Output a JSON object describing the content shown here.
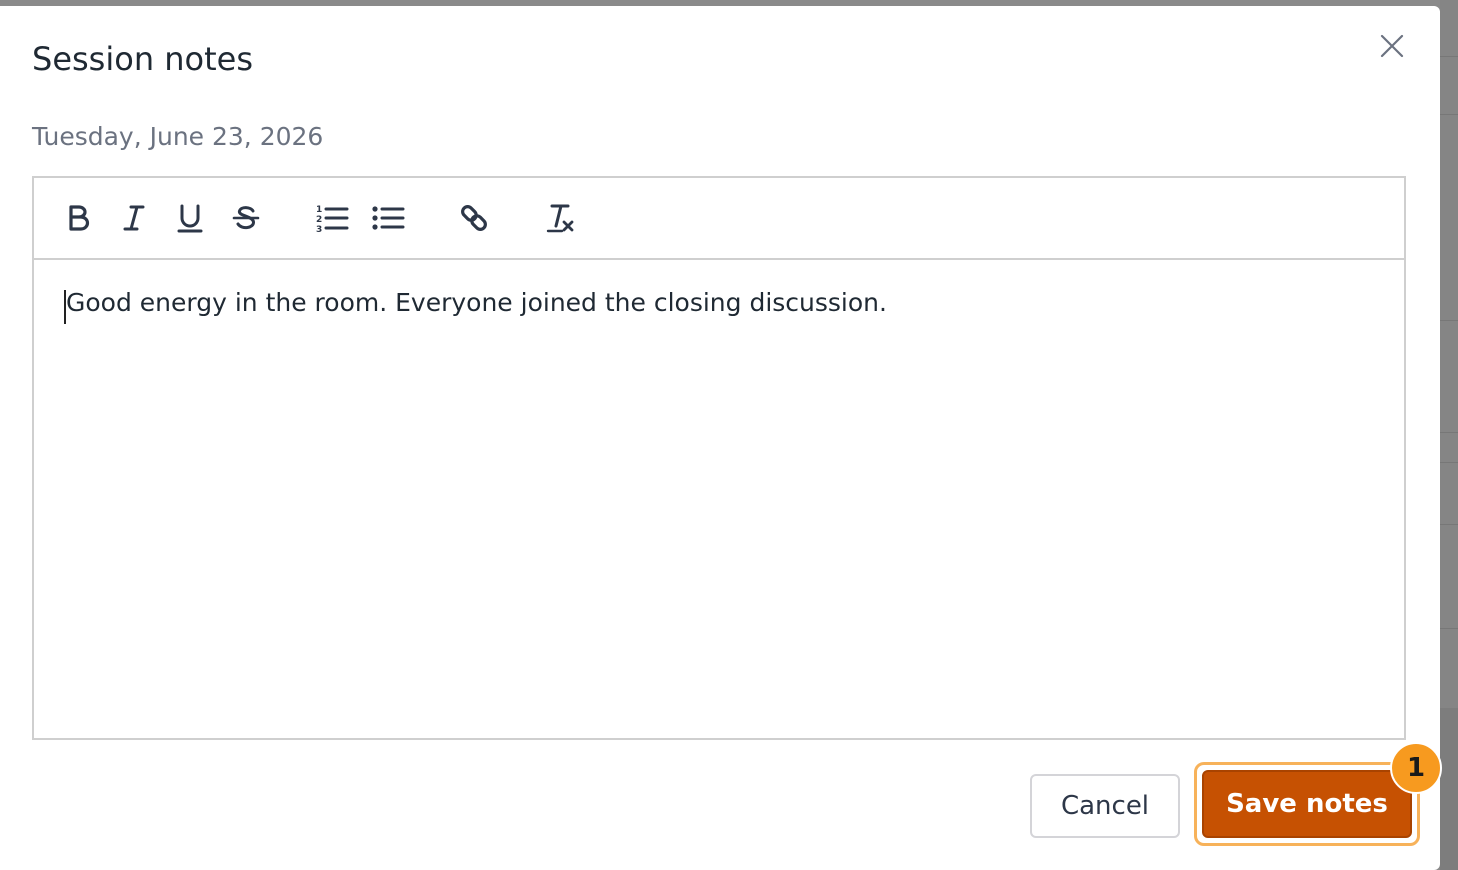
{
  "dialog": {
    "title": "Session notes",
    "date": "Tuesday, June 23, 2026"
  },
  "editor": {
    "toolbar": [
      {
        "name": "bold",
        "icon": "bold-icon"
      },
      {
        "name": "italic",
        "icon": "italic-icon"
      },
      {
        "name": "underline",
        "icon": "underline-icon"
      },
      {
        "name": "strikethrough",
        "icon": "strikethrough-icon"
      },
      {
        "name": "ordered-list",
        "icon": "ordered-list-icon"
      },
      {
        "name": "bullet-list",
        "icon": "bullet-list-icon"
      },
      {
        "name": "link",
        "icon": "link-icon"
      },
      {
        "name": "clear-formatting",
        "icon": "clear-formatting-icon"
      }
    ],
    "content": "Good energy in the room. Everyone joined the closing discussion."
  },
  "footer": {
    "cancel_label": "Cancel",
    "save_label": "Save notes",
    "badge_count": "1"
  },
  "colors": {
    "primary": "#c65102",
    "focus_ring": "#f7b25a",
    "badge": "#f79a1f"
  }
}
